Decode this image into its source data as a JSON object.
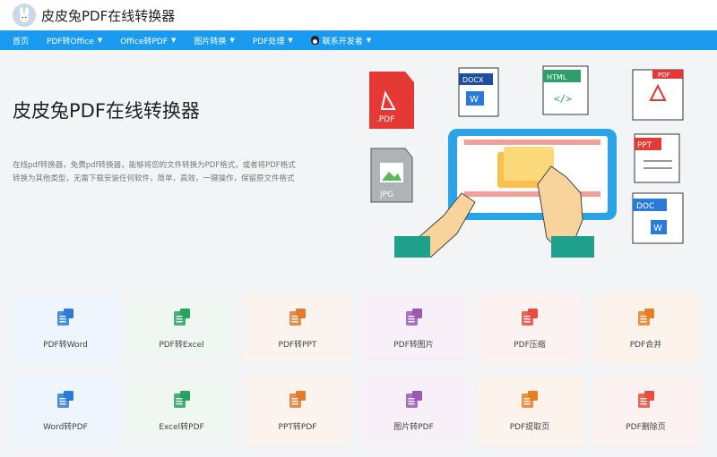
{
  "header": {
    "brand": "皮皮兔PDF在线转换器"
  },
  "nav": [
    {
      "label": "首页",
      "dropdown": false
    },
    {
      "label": "PDF转Office",
      "dropdown": true
    },
    {
      "label": "Office转PDF",
      "dropdown": true
    },
    {
      "label": "图片转换",
      "dropdown": true
    },
    {
      "label": "PDF处理",
      "dropdown": true
    },
    {
      "label": "联系开发者",
      "dropdown": true,
      "icon": "penguin-icon"
    }
  ],
  "hero": {
    "title": "皮皮兔PDF在线转换器",
    "description": "在线pdf转换器，免费pdf转换器，能够将您的文件转换为PDF格式，或者将PDF格式转换为其他类型，无需下载安装任何软件，简单，高效，一键操作，保留原文件格式"
  },
  "illustration": {
    "docs": [
      {
        "label": ".PDF",
        "color": "#e53935"
      },
      {
        "label": "DOCX",
        "color": "#1f4e9c"
      },
      {
        "label": "HTML",
        "color": "#2e9f6a"
      },
      {
        "label": "PDF",
        "color": "#e53935"
      },
      {
        "label": "JPG",
        "color": "#9e9e9e"
      },
      {
        "label": "PPT",
        "color": "#e53935"
      },
      {
        "label": "DOC",
        "color": "#2a7ad9"
      }
    ]
  },
  "tools": [
    {
      "label": "PDF转Word",
      "icon": "pdf-to-word-icon",
      "color": "#2a7ad9",
      "bg": "#eef5fc"
    },
    {
      "label": "PDF转Excel",
      "icon": "pdf-to-excel-icon",
      "color": "#27a260",
      "bg": "#f0f7f2"
    },
    {
      "label": "PDF转PPT",
      "icon": "pdf-to-ppt-icon",
      "color": "#e07b2e",
      "bg": "#fbf4ee"
    },
    {
      "label": "PDF转图片",
      "icon": "pdf-to-image-icon",
      "color": "#9b59b6",
      "bg": "#f7f0f8"
    },
    {
      "label": "PDF压缩",
      "icon": "pdf-compress-icon",
      "color": "#e74c3c",
      "bg": "#fbf2f1"
    },
    {
      "label": "PDF合并",
      "icon": "pdf-merge-icon",
      "color": "#e67e22",
      "bg": "#fbf3ec"
    },
    {
      "label": "Word转PDF",
      "icon": "word-to-pdf-icon",
      "color": "#2a7ad9",
      "bg": "#eef5fc"
    },
    {
      "label": "Excel转PDF",
      "icon": "excel-to-pdf-icon",
      "color": "#27a260",
      "bg": "#f0f7f2"
    },
    {
      "label": "PPT转PDF",
      "icon": "ppt-to-pdf-icon",
      "color": "#e07b2e",
      "bg": "#fbf4ee"
    },
    {
      "label": "图片转PDF",
      "icon": "image-to-pdf-icon",
      "color": "#9b59b6",
      "bg": "#f7f0f8"
    },
    {
      "label": "PDF提取页",
      "icon": "pdf-extract-icon",
      "color": "#e67e22",
      "bg": "#fbf3ec"
    },
    {
      "label": "PDF删除页",
      "icon": "pdf-delete-icon",
      "color": "#e74c3c",
      "bg": "#fbf2f1"
    }
  ]
}
